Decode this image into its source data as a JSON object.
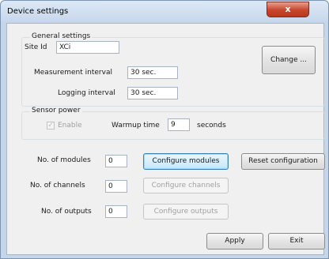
{
  "window": {
    "title": "Device settings",
    "close_label": "x"
  },
  "general": {
    "title": "General settings",
    "site_id_label": "Site Id",
    "site_id_value": "XCi",
    "measurement_label": "Measurement interval",
    "measurement_value": "30 sec.",
    "logging_label": "Logging interval",
    "logging_value": "30 sec.",
    "change_label": "Change ..."
  },
  "sensor": {
    "title": "Sensor power",
    "enable_label": "Enable",
    "enable_checked": true,
    "warmup_label": "Warmup time",
    "warmup_value": "9",
    "warmup_unit": "seconds"
  },
  "modules": {
    "label": "No. of modules",
    "value": "0",
    "configure_label": "Configure modules",
    "reset_label": "Reset configuration"
  },
  "channels": {
    "label": "No. of channels",
    "value": "0",
    "configure_label": "Configure channels"
  },
  "outputs": {
    "label": "No. of outputs",
    "value": "0",
    "configure_label": "Configure outputs"
  },
  "footer": {
    "apply_label": "Apply",
    "exit_label": "Exit"
  }
}
